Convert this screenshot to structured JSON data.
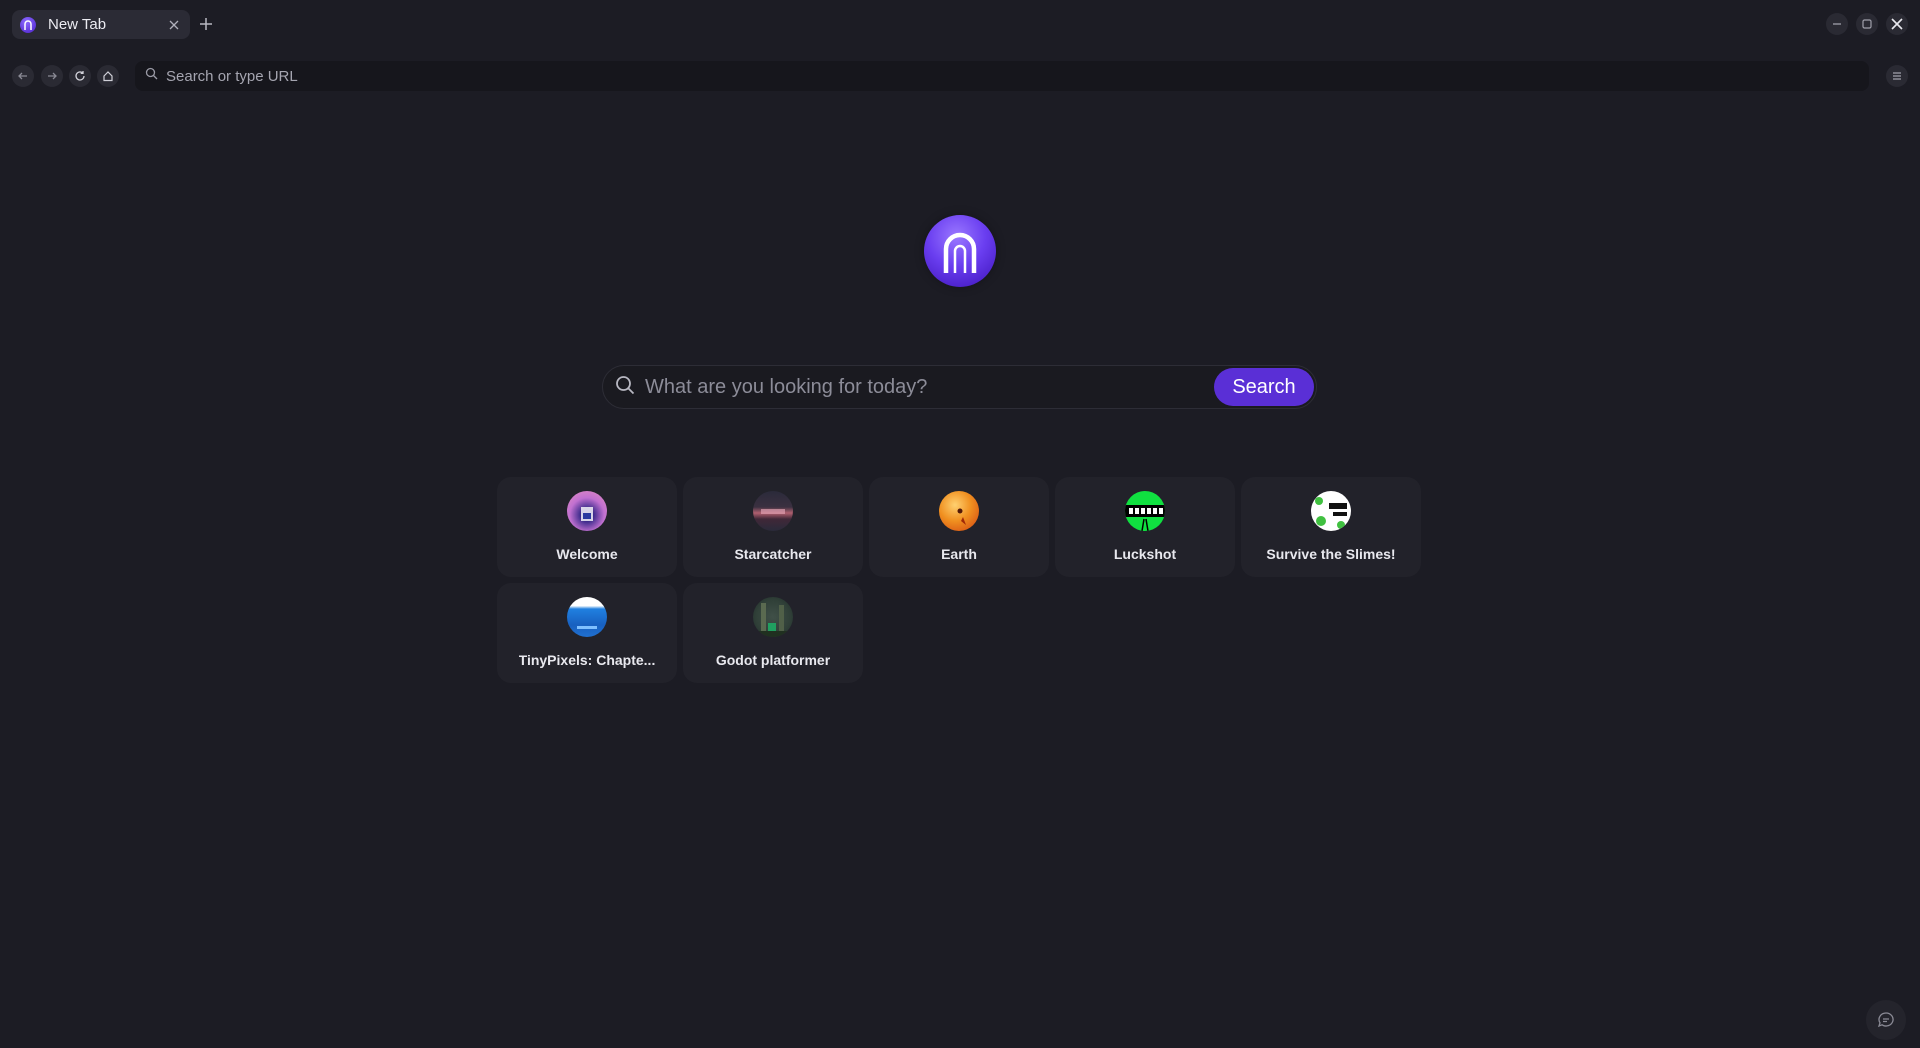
{
  "tab": {
    "title": "New Tab",
    "favicon": "browser-logo-icon"
  },
  "toolbar": {
    "url_placeholder": "Search or type URL",
    "icons": [
      "back-arrow-icon",
      "forward-arrow-icon",
      "reload-icon",
      "home-icon",
      "menu-icon"
    ]
  },
  "main": {
    "search_placeholder": "What are you looking for today?",
    "search_button": "Search",
    "accent_color": "#5a2fd6",
    "shortcuts": [
      {
        "label": "Welcome",
        "icon": "welcome-thumbnail"
      },
      {
        "label": "Starcatcher",
        "icon": "starcatcher-thumbnail"
      },
      {
        "label": "Earth",
        "icon": "earth-thumbnail"
      },
      {
        "label": "Luckshot",
        "icon": "luckshot-thumbnail"
      },
      {
        "label": "Survive the Slimes!",
        "icon": "survive-the-slimes-thumbnail"
      },
      {
        "label": "TinyPixels: Chapte...",
        "icon": "tinypixels-thumbnail"
      },
      {
        "label": "Godot platformer",
        "icon": "godot-platformer-thumbnail"
      }
    ]
  },
  "colors": {
    "background": "#1c1c24",
    "tile": "#22222a",
    "logo": "#6a3ef0"
  }
}
